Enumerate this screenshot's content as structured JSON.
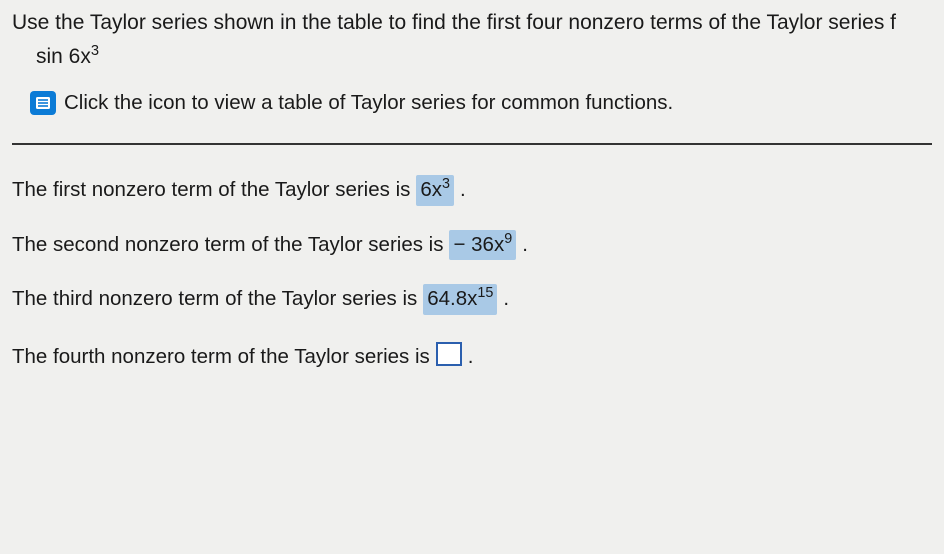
{
  "instruction": "Use the Taylor series shown in the table to find the first four nonzero terms of the Taylor series f",
  "expression_prefix": "sin 6x",
  "expression_exponent": "3",
  "link_text": "Click the icon to view a table of Taylor series for common functions.",
  "answers": {
    "line1_prefix": "The first nonzero term of the Taylor series is",
    "line1_value_base": "6x",
    "line1_value_exp": "3",
    "line2_prefix": "The second nonzero term of the Taylor series is",
    "line2_value_sign": " − ",
    "line2_value_base": "36x",
    "line2_value_exp": "9",
    "line3_prefix": "The third nonzero term of the Taylor series is",
    "line3_value_base": "64.8x",
    "line3_value_exp": "15",
    "line4_prefix": "The fourth nonzero term of the Taylor series is",
    "period": "."
  }
}
